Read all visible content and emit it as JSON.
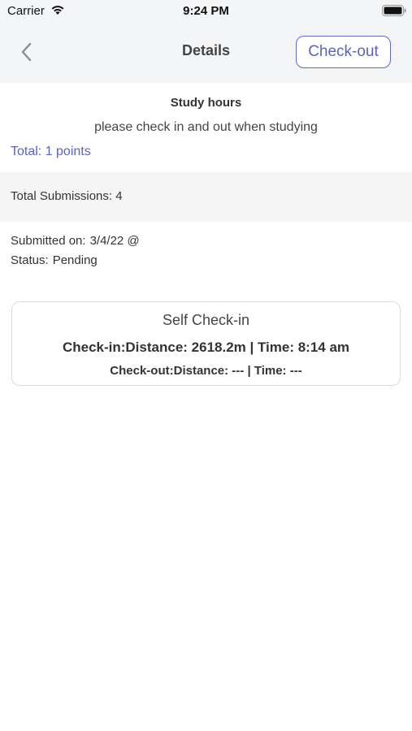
{
  "status_bar": {
    "carrier": "Carrier",
    "time": "9:24 PM",
    "icons": [
      "wifi-icon",
      "battery-icon"
    ]
  },
  "nav": {
    "title": "Details",
    "back_icon": "chevron-left-icon",
    "checkout_label": "Check-out",
    "accent_color": "#5a62c4"
  },
  "task": {
    "title": "Study hours",
    "description": "please check in and out when studying",
    "total_points": "Total: 1 points"
  },
  "submissions": {
    "total": "Total Submissions: 4"
  },
  "submission_info": {
    "submitted_label": "Submitted on:",
    "submitted_value": "3/4/22 @",
    "status_label": "Status:",
    "status_value": "Pending"
  },
  "checkin_card": {
    "title": "Self Check-in",
    "checkin_line": "Check-in:Distance: 2618.2m | Time: 8:14 am",
    "checkout_line": "Check-out:Distance: --- | Time: ---"
  }
}
